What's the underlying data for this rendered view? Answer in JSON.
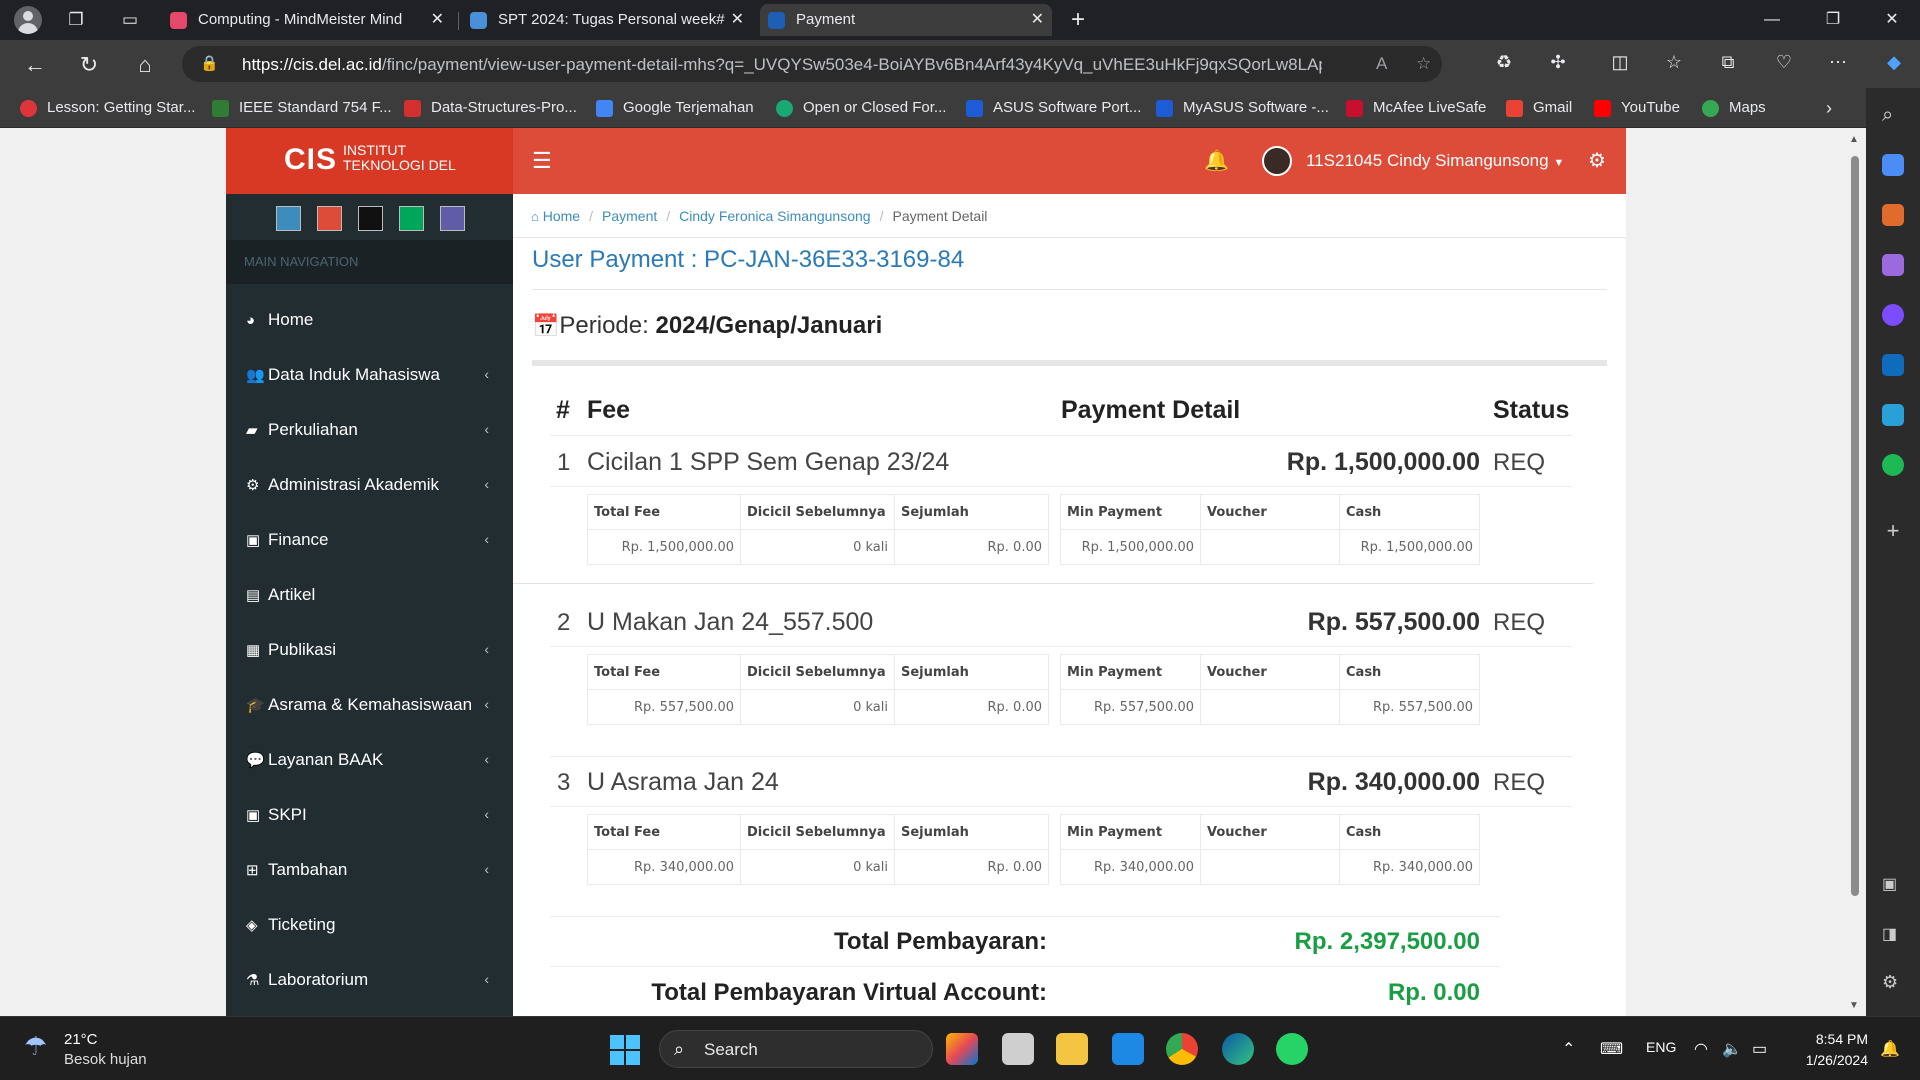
{
  "browser": {
    "tabs": [
      {
        "title": "Computing - MindMeister Mind",
        "favicon_color": "#e5486a"
      },
      {
        "title": "SPT 2024: Tugas Personal week#",
        "favicon_color": "#4a90d9"
      },
      {
        "title": "Payment",
        "favicon_color": "#1d5fb4"
      }
    ],
    "new_tab_label": "+",
    "url_domain": "https://cis.del.ac.id",
    "url_path": "/finc/payment/view-user-payment-detail-mhs?q=_UVQYSw503e4-BoiAYBv6Bn4Arf43y4KyVq_uVhEE3uHkFj9qxSQorLw8LApp...",
    "bookmarks": [
      {
        "label": "Lesson: Getting Star...",
        "color": "#e0343b"
      },
      {
        "label": "IEEE Standard 754 F...",
        "color": "#2e7d32"
      },
      {
        "label": "Data-Structures-Pro...",
        "color": "#d32f2f"
      },
      {
        "label": "Google Terjemahan",
        "color": "#4285f4"
      },
      {
        "label": "Open or Closed For...",
        "color": "#19a974"
      },
      {
        "label": "ASUS Software Port...",
        "color": "#1e5bd6"
      },
      {
        "label": "MyASUS Software -...",
        "color": "#1e5bd6"
      },
      {
        "label": "McAfee LiveSafe",
        "color": "#c8102e"
      },
      {
        "label": "Gmail",
        "color": "#ea4335"
      },
      {
        "label": "YouTube",
        "color": "#ff0000"
      },
      {
        "label": "Maps",
        "color": "#34a853"
      }
    ]
  },
  "header": {
    "logo_main": "CIS",
    "logo_sub1": "INSTITUT",
    "logo_sub2": "TEKNOLOGI DEL",
    "user_name": "11S21045 Cindy Simangunsong"
  },
  "sidebar": {
    "skin_colors": [
      "#3c8dbc",
      "#dd4b39",
      "#111111",
      "#00a65a",
      "#605ca8"
    ],
    "section_label": "MAIN NAVIGATION",
    "items": [
      {
        "label": "Home",
        "icon": "dashboard-icon",
        "has_children": false
      },
      {
        "label": "Data Induk Mahasiswa",
        "icon": "users-icon",
        "has_children": true
      },
      {
        "label": "Perkuliahan",
        "icon": "book-icon",
        "has_children": true
      },
      {
        "label": "Administrasi Akademik",
        "icon": "cogs-icon",
        "has_children": true
      },
      {
        "label": "Finance",
        "icon": "money-icon",
        "has_children": true
      },
      {
        "label": "Artikel",
        "icon": "file-icon",
        "has_children": false
      },
      {
        "label": "Publikasi",
        "icon": "newspaper-icon",
        "has_children": true
      },
      {
        "label": "Asrama & Kemahasiswaan",
        "icon": "graduation-cap-icon",
        "has_children": true
      },
      {
        "label": "Layanan BAAK",
        "icon": "comments-icon",
        "has_children": true
      },
      {
        "label": "SKPI",
        "icon": "archive-icon",
        "has_children": true
      },
      {
        "label": "Tambahan",
        "icon": "plus-square-icon",
        "has_children": true
      },
      {
        "label": "Ticketing",
        "icon": "tag-icon",
        "has_children": false
      },
      {
        "label": "Laboratorium",
        "icon": "flask-icon",
        "has_children": true
      }
    ]
  },
  "breadcrumb": {
    "home": "Home",
    "payment": "Payment",
    "user": "Cindy Feronica Simangunsong",
    "current": "Payment Detail"
  },
  "page": {
    "title": "User Payment : PC-JAN-36E33-3169-84",
    "periode_label": "Periode:",
    "periode_value": "2024/Genap/Januari"
  },
  "table": {
    "headers": {
      "num": "#",
      "fee": "Fee",
      "detail": "Payment Detail",
      "status": "Status"
    },
    "sub_headers": [
      "Total Fee",
      "Dicicil Sebelumnya",
      "Sejumlah",
      "Min Payment",
      "Voucher",
      "Cash"
    ],
    "rows": [
      {
        "num": "1",
        "name": "Cicilan 1 SPP Sem Genap 23/24",
        "amount": "Rp. 1,500,000.00",
        "status": "REQ",
        "total_fee": "Rp. 1,500,000.00",
        "dicicil": "0 kali",
        "sejumlah": "Rp. 0.00",
        "min_payment": "Rp. 1,500,000.00",
        "voucher": "",
        "cash": "Rp. 1,500,000.00"
      },
      {
        "num": "2",
        "name": "U Makan Jan 24_557.500",
        "amount": "Rp. 557,500.00",
        "status": "REQ",
        "total_fee": "Rp. 557,500.00",
        "dicicil": "0 kali",
        "sejumlah": "Rp. 0.00",
        "min_payment": "Rp. 557,500.00",
        "voucher": "",
        "cash": "Rp. 557,500.00"
      },
      {
        "num": "3",
        "name": "U Asrama Jan 24",
        "amount": "Rp. 340,000.00",
        "status": "REQ",
        "total_fee": "Rp. 340,000.00",
        "dicicil": "0 kali",
        "sejumlah": "Rp. 0.00",
        "min_payment": "Rp. 340,000.00",
        "voucher": "",
        "cash": "Rp. 340,000.00"
      }
    ]
  },
  "totals": {
    "total_label": "Total Pembayaran:",
    "total_value": "Rp. 2,397,500.00",
    "va_label": "Total Pembayaran Virtual Account:",
    "va_value": "Rp. 0.00",
    "value_color": "#1a9e44"
  },
  "taskbar": {
    "temp": "21°C",
    "weather": "Besok hujan",
    "search_label": "Search",
    "lang": "ENG",
    "time": "8:54 PM",
    "date": "1/26/2024"
  },
  "colors": {
    "header_red": "#dd4b39",
    "sidebar_dark": "#222d32",
    "link_blue": "#3c8dbc"
  }
}
